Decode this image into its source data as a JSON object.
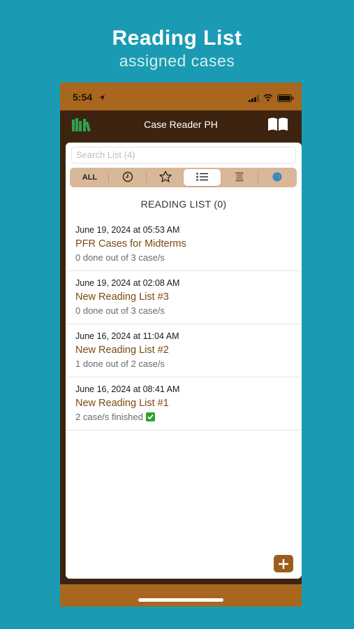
{
  "promo": {
    "title": "Reading List",
    "subtitle": "assigned cases"
  },
  "status_bar": {
    "time": "5:54",
    "icons": [
      "location-arrow-icon",
      "signal-icon",
      "wifi-icon",
      "battery-icon"
    ]
  },
  "nav": {
    "title": "Case Reader PH",
    "left_icon": "books-app-icon",
    "right_icon": "open-book-icon"
  },
  "search": {
    "placeholder": "Search List (4)"
  },
  "segments": {
    "all_label": "ALL",
    "icons": [
      "clock-icon",
      "star-icon",
      "list-icon",
      "scroll-icon",
      "globe-icon"
    ],
    "selected": "list-icon"
  },
  "section": {
    "title": "READING LIST (0)"
  },
  "reading_lists": [
    {
      "date": "June 19, 2024 at 05:53 AM",
      "title": "PFR Cases for Midterms",
      "status": "0 done out of 3 case/s"
    },
    {
      "date": "June 19, 2024 at 02:08 AM",
      "title": "New Reading List #3",
      "status": "0 done out of 3 case/s"
    },
    {
      "date": "June 16, 2024 at 11:04 AM",
      "title": "New Reading List #2",
      "status": "1 done out of 2 case/s"
    },
    {
      "date": "June 16, 2024 at 08:41 AM",
      "title": "New Reading List #1",
      "status": "2 case/s finished"
    }
  ],
  "colors": {
    "background": "#1a9bb3",
    "header_brown": "#3d2410",
    "status_bar": "#a8661e",
    "accent": "#7a4a10",
    "segment_bg": "#d8b898"
  }
}
